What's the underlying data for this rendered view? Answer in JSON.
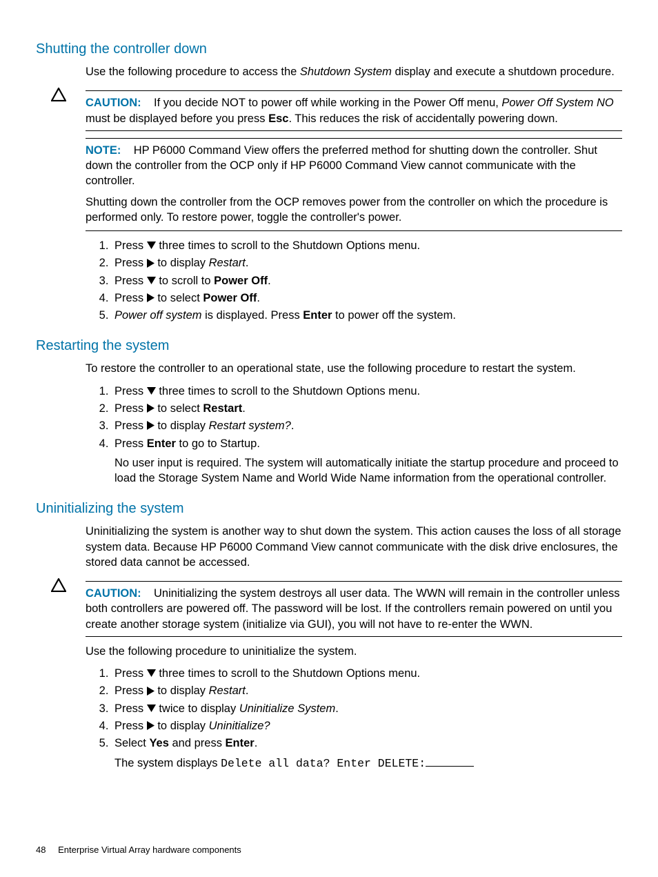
{
  "section1": {
    "heading": "Shutting the controller down",
    "intro_a": "Use the following procedure to access the ",
    "intro_b_italic": "Shutdown System",
    "intro_c": " display and execute a shutdown procedure.",
    "caution_label": "CAUTION:",
    "caution_a": "If you decide NOT to power off while working in the Power Off menu, ",
    "caution_b_italic": "Power Off System NO",
    "caution_c": " must be displayed before you press ",
    "caution_d_bold": "Esc",
    "caution_e": ". This reduces the risk of accidentally powering down.",
    "note_label": "NOTE:",
    "note_p1": "HP P6000 Command View offers the preferred method for shutting down the controller. Shut down the controller from the OCP only if HP P6000 Command View cannot communicate with the controller.",
    "note_p2": "Shutting down the controller from the OCP removes power from the controller on which the procedure is performed only. To restore power, toggle the controller's power.",
    "steps": {
      "s1_a": "Press ",
      "s1_b": " three times to scroll to the Shutdown Options menu.",
      "s2_a": "Press ",
      "s2_b": " to display ",
      "s2_c_italic": "Restart",
      "s2_d": ".",
      "s3_a": "Press ",
      "s3_b": " to scroll to ",
      "s3_c_bold": "Power Off",
      "s3_d": ".",
      "s4_a": "Press ",
      "s4_b": " to select ",
      "s4_c_bold": "Power Off",
      "s4_d": ".",
      "s5_a_italic": "Power off system",
      "s5_b": " is displayed. Press ",
      "s5_c_bold": "Enter",
      "s5_d": " to power off the system."
    }
  },
  "section2": {
    "heading": "Restarting the system",
    "intro": "To restore the controller to an operational state, use the following procedure to restart the system.",
    "steps": {
      "s1_a": "Press ",
      "s1_b": " three times to scroll to the Shutdown Options menu.",
      "s2_a": "Press ",
      "s2_b": " to select ",
      "s2_c_bold": "Restart",
      "s2_d": ".",
      "s3_a": "Press ",
      "s3_b": " to display ",
      "s3_c_italic": "Restart system?",
      "s3_d": ".",
      "s4_a": "Press ",
      "s4_b_bold": "Enter",
      "s4_c": " to go to Startup.",
      "s4_note": "No user input is required. The system will automatically initiate the startup procedure and proceed to load the Storage System Name and World Wide Name information from the operational controller."
    }
  },
  "section3": {
    "heading": "Uninitializing the system",
    "intro": "Uninitializing the system is another way to shut down the system. This action causes the loss of all storage system data. Because HP P6000 Command View cannot communicate with the disk drive enclosures, the stored data cannot be accessed.",
    "caution_label": "CAUTION:",
    "caution_text": "Uninitializing the system destroys all user data. The WWN will remain in the controller unless both controllers are powered off. The password will be lost. If the controllers remain powered on until you create another storage system (initialize via GUI), you will not have to re-enter the WWN.",
    "post": "Use the following procedure to uninitialize the system.",
    "steps": {
      "s1_a": "Press ",
      "s1_b": " three times to scroll to the Shutdown Options menu.",
      "s2_a": "Press ",
      "s2_b": " to display ",
      "s2_c_italic": "Restart",
      "s2_d": ".",
      "s3_a": "Press ",
      "s3_b": " twice to display ",
      "s3_c_italic": "Uninitialize System",
      "s3_d": ".",
      "s4_a": "Press ",
      "s4_b": " to display ",
      "s4_c_italic": "Uninitialize?",
      "s5_a": "Select ",
      "s5_b_bold": "Yes",
      "s5_c": " and press ",
      "s5_d_bold": "Enter",
      "s5_e": ".",
      "s5_note_a": "The system displays ",
      "s5_note_mono": "Delete all data? Enter DELETE:"
    }
  },
  "footer": {
    "page": "48",
    "title": "Enterprise Virtual Array hardware components"
  }
}
